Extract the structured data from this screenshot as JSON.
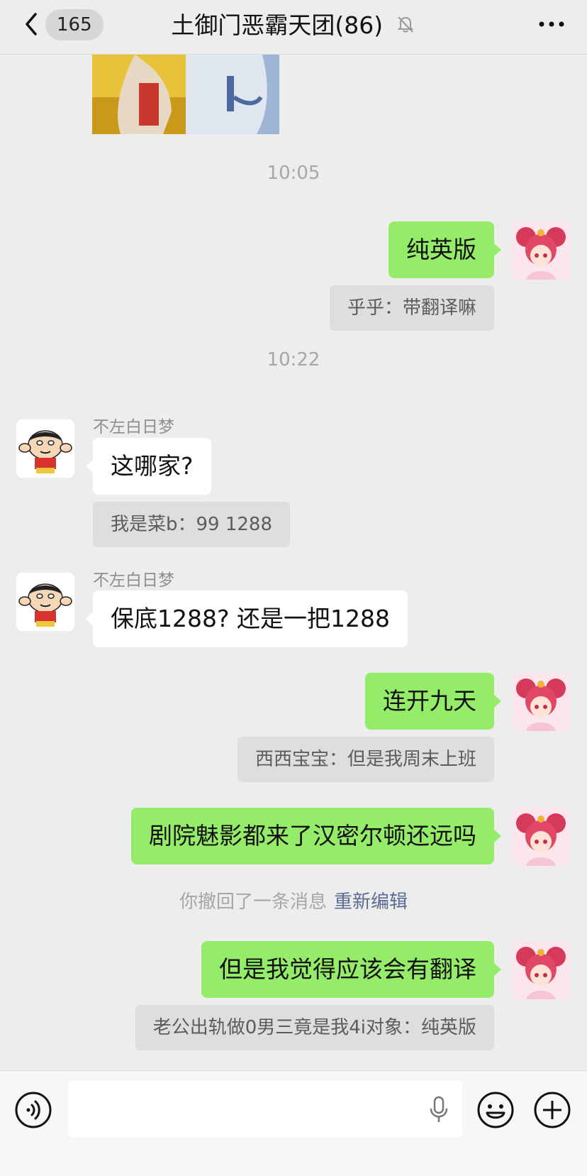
{
  "header": {
    "unread_count": "165",
    "title": "土御门恶霸天团(86)"
  },
  "messages": {
    "time1": "10:05",
    "m1": "纯英版",
    "q1": "乎乎：带翻译嘛",
    "time2": "10:22",
    "sender1": "不左白日梦",
    "m2": "这哪家?",
    "q2": "我是菜b：99 1288",
    "sender2": "不左白日梦",
    "m3": "保底1288?  还是一把1288",
    "m4": "连开九天",
    "q3": "西西宝宝：但是我周末上班",
    "m5": "剧院魅影都来了汉密尔顿还远吗",
    "recall_text": "你撤回了一条消息",
    "recall_edit": "重新编辑",
    "m6": "但是我觉得应该会有翻译",
    "q4": "老公出轨做0男三竟是我4i对象：纯英版"
  },
  "colors": {
    "my_bubble": "#95ec69",
    "their_bubble": "#ffffff",
    "link": "#5b6b92",
    "background": "#ededed"
  },
  "icons": [
    "back-arrow-icon",
    "mute-bell-icon",
    "more-dots-icon",
    "voice-icon",
    "mic-icon",
    "emoji-icon",
    "plus-icon"
  ]
}
